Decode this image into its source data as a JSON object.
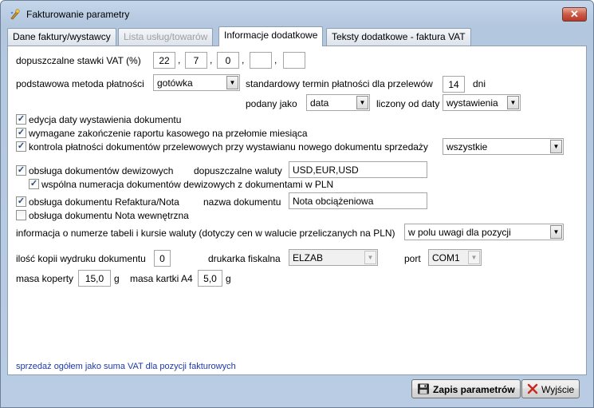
{
  "window": {
    "title": "Fakturowanie parametry",
    "close": "✕"
  },
  "tabs": [
    {
      "label": "Dane faktury/wystawcy",
      "state": "normal"
    },
    {
      "label": "Lista usług/towarów",
      "state": "disabled"
    },
    {
      "label": "Informacje dodatkowe",
      "state": "active"
    },
    {
      "label": "Teksty dodatkowe - faktura VAT",
      "state": "normal"
    }
  ],
  "vat": {
    "label": "dopuszczalne stawki VAT (%)",
    "values": [
      "22",
      "7",
      "0",
      "",
      ""
    ],
    "separators": [
      ",",
      ",",
      ",",
      ","
    ]
  },
  "payment": {
    "label": "podstawowa metoda płatności",
    "method": "gotówka",
    "term_label": "standardowy termin płatności dla przelewów",
    "term_value": "14",
    "term_unit": "dni",
    "given_as_label": "podany jako",
    "given_as_value": "data",
    "counted_from_label": "liczony od daty",
    "counted_from_value": "wystawienia"
  },
  "checks": {
    "edit_date": {
      "label": "edycja daty wystawienia dokumentu",
      "checked": true
    },
    "cash_report": {
      "label": "wymagane zakończenie raportu kasowego na przełomie miesiąca",
      "checked": true
    },
    "payment_control": {
      "label": "kontrola płatności dokumentów przelewowych przy wystawianu nowego dokumentu sprzedaży",
      "checked": true,
      "select_value": "wszystkie"
    },
    "currency_docs": {
      "label": "obsługa dokumentów dewizowych",
      "checked": true
    },
    "shared_numbering": {
      "label": "wspólna numeracja dokumentów dewizowych z dokumentami w PLN",
      "checked": true
    },
    "refaktura": {
      "label": "obsługa dokumentu Refaktura/Nota",
      "checked": true
    },
    "nota_internal": {
      "label": "obsługa dokumentu Nota wewnętrzna",
      "checked": false
    }
  },
  "currencies": {
    "label": "dopuszczalne waluty",
    "value": "USD,EUR,USD"
  },
  "doc_name": {
    "label": "nazwa dokumentu",
    "value": "Nota obciążeniowa"
  },
  "table_info": {
    "label": "informacja o numerze tabeli i kursie waluty (dotyczy cen w walucie przeliczanych na PLN)",
    "value": "w polu uwagi dla pozycji"
  },
  "print": {
    "copies_label": "ilość kopii wydruku dokumentu",
    "copies_value": "0",
    "printer_label": "drukarka fiskalna",
    "printer_value": "ELZAB",
    "port_label": "port",
    "port_value": "COM1"
  },
  "mass": {
    "envelope_label": "masa koperty",
    "envelope_value": "15,0",
    "envelope_unit": "g",
    "a4_label": "masa kartki A4",
    "a4_value": "5,0",
    "a4_unit": "g"
  },
  "note": "sprzedaż ogółem jako suma VAT dla pozycji fakturowych",
  "buttons": {
    "save": "Zapis parametrów",
    "exit": "Wyjście"
  },
  "colors": {
    "accent_note": "#1f3aa8",
    "check": "#2b4a78",
    "close_red": "#cc5a44"
  }
}
